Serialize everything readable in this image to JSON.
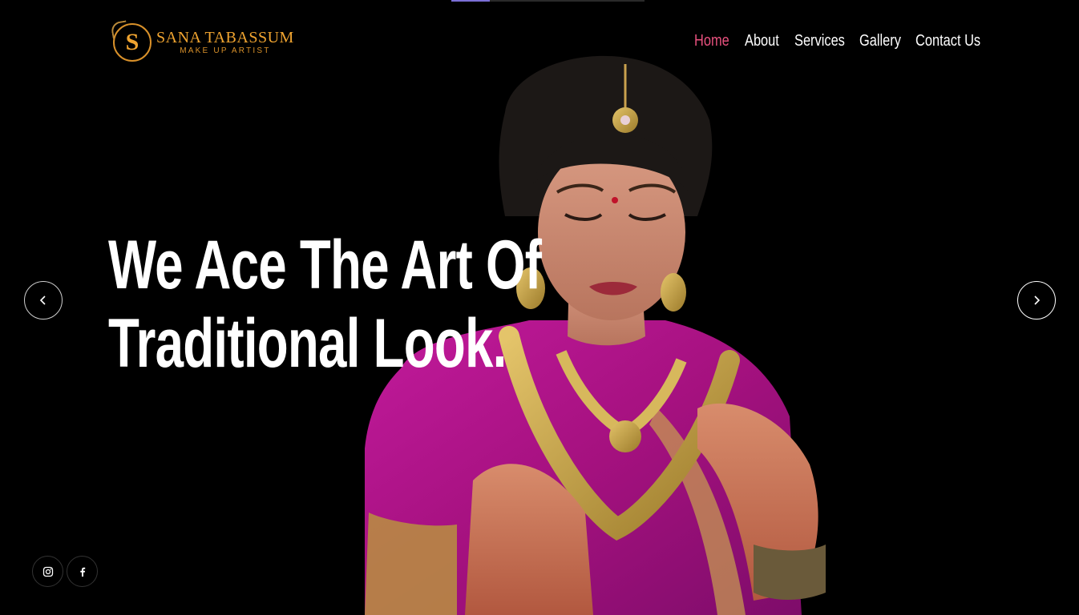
{
  "logo": {
    "mark": "S",
    "name": "SANA TABASSUM",
    "tagline": "MAKE UP ARTIST"
  },
  "nav": {
    "items": [
      {
        "label": "Home",
        "active": true
      },
      {
        "label": "About",
        "active": false
      },
      {
        "label": "Services",
        "active": false
      },
      {
        "label": "Gallery",
        "active": false
      },
      {
        "label": "Contact Us",
        "active": false
      }
    ]
  },
  "hero": {
    "line1": "We Ace The Art Of",
    "line2": "Traditional Look."
  },
  "carousel": {
    "prev_icon": "chevron-left-icon",
    "next_icon": "chevron-right-icon"
  },
  "social": {
    "icons": [
      "instagram-icon",
      "facebook-icon"
    ]
  },
  "colors": {
    "accent": "#e8517e",
    "logo_gold": "#f0a430",
    "background": "#000000"
  }
}
